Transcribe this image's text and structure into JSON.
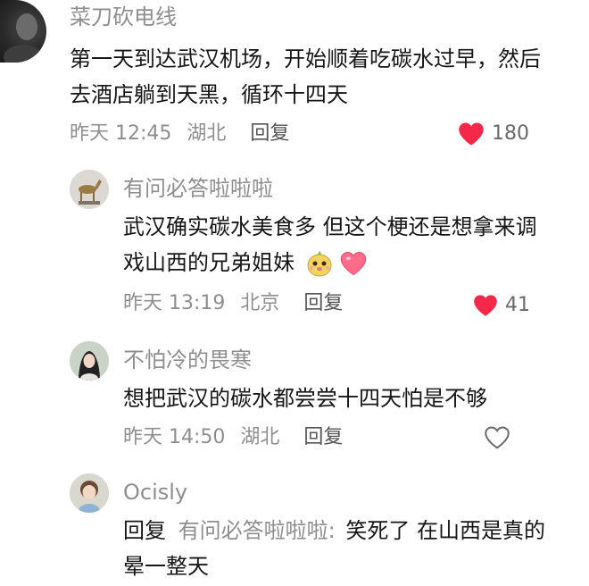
{
  "comments": [
    {
      "username": "菜刀砍电线",
      "lines": [
        "第一天到达武汉机场，开始顺着吃碳水过早，然后",
        "去酒店躺到天黑，循环十四天"
      ],
      "time": "昨天 12:45",
      "location": "湖北",
      "reply_label": "回复",
      "likes": "180",
      "liked": true
    }
  ],
  "replies": [
    {
      "username": "有问必答啦啦啦",
      "lines": [
        "武汉确实碳水美食多 但这个梗还是想拿来调",
        "戏山西的兄弟姐妹"
      ],
      "time": "昨天 13:19",
      "location": "北京",
      "reply_label": "回复",
      "likes": "41",
      "liked": true
    },
    {
      "username": "不怕冷的畏寒",
      "lines": [
        "想把武汉的碳水都尝尝十四天怕是不够"
      ],
      "time": "昨天 14:50",
      "location": "湖北",
      "reply_label": "回复",
      "liked": false
    },
    {
      "username": "Ocisly",
      "reply_prefix": "回复",
      "reply_to": "有问必答啦啦啦:",
      "lines": [
        "笑死了 在山西是真的",
        "晕一整天"
      ]
    }
  ],
  "colors": {
    "like_red": "#f5284a",
    "muted": "#8e8e8e",
    "text": "#161616"
  }
}
